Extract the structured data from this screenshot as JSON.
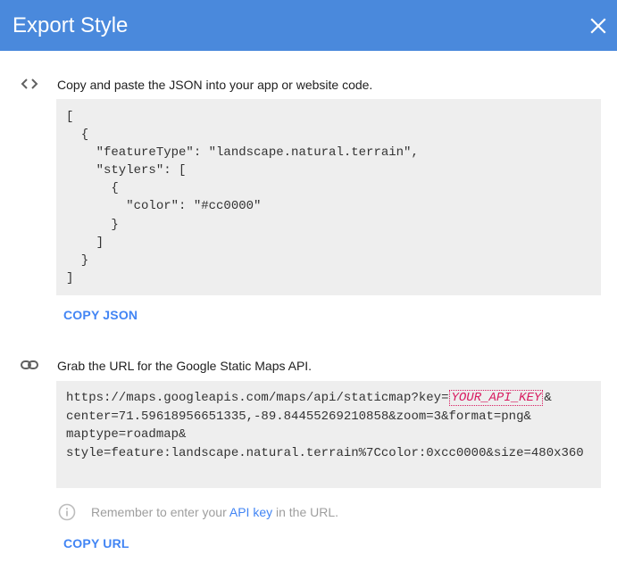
{
  "dialog": {
    "title": "Export Style",
    "close_icon": "close-icon",
    "header_color": "#4a89dc"
  },
  "json_section": {
    "icon": "code-icon",
    "instruction": "Copy and paste the JSON into your app or website code.",
    "code": "[\n  {\n    \"featureType\": \"landscape.natural.terrain\",\n    \"stylers\": [\n      {\n        \"color\": \"#cc0000\"\n      }\n    ]\n  }\n]",
    "copy_label": "COPY JSON"
  },
  "url_section": {
    "icon": "link-icon",
    "instruction": "Grab the URL for the Google Static Maps API.",
    "url_line1_prefix": "https://maps.googleapis.com/maps/api/staticmap?key=",
    "api_key_placeholder": "YOUR_API_KEY",
    "url_line1_suffix": "&",
    "url_line2": "center=71.59618956651335,-89.84455269210858&zoom=3&format=png&",
    "url_line3": "maptype=roadmap&",
    "url_line4": "style=feature:landscape.natural.terrain%7Ccolor:0xcc0000&size=480x360",
    "note_icon": "info-icon",
    "note_prefix": "Remember to enter your ",
    "note_link": "API key",
    "note_suffix": " in the URL.",
    "copy_label": "COPY URL"
  },
  "colors": {
    "accent": "#4285f4",
    "code_bg": "#eeeeee",
    "api_key": "#d81b60"
  }
}
